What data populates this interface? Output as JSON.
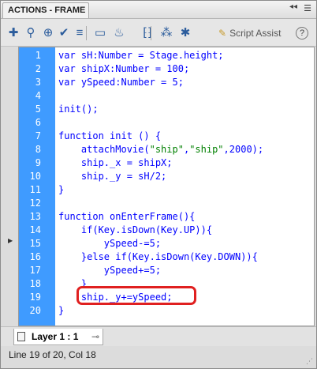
{
  "panel": {
    "title": "ACTIONS - FRAME"
  },
  "toolbar": {
    "buttons": [
      {
        "name": "add-script-item-icon",
        "glyph": "✚"
      },
      {
        "name": "find-icon",
        "glyph": "⚲"
      },
      {
        "name": "target-path-icon",
        "glyph": "⊕"
      },
      {
        "name": "check-syntax-icon",
        "glyph": "✔"
      },
      {
        "name": "auto-format-icon",
        "glyph": "≡"
      },
      {
        "name": "code-hint-icon",
        "glyph": "▭"
      },
      {
        "name": "debug-options-icon",
        "glyph": "♨"
      },
      {
        "name": "collapse-between-braces-icon",
        "glyph": "⁅⁆"
      },
      {
        "name": "collapse-selection-icon",
        "glyph": "⁂"
      },
      {
        "name": "expand-all-icon",
        "glyph": "✱"
      }
    ],
    "script_assist_label": "Script Assist",
    "help_label": "?"
  },
  "code_lines": [
    {
      "num": "1",
      "text": "var sH:Number = Stage.height;"
    },
    {
      "num": "2",
      "text": "var shipX:Number = 100;"
    },
    {
      "num": "3",
      "text": "var ySpeed:Number = 5;"
    },
    {
      "num": "4",
      "text": ""
    },
    {
      "num": "5",
      "text": "init();"
    },
    {
      "num": "6",
      "text": ""
    },
    {
      "num": "7",
      "text": "function init () {"
    },
    {
      "num": "8",
      "text": "    attachMovie(\"ship\",\"ship\",2000);"
    },
    {
      "num": "9",
      "text": "    ship._x = shipX;"
    },
    {
      "num": "10",
      "text": "    ship._y = sH/2;"
    },
    {
      "num": "11",
      "text": "}"
    },
    {
      "num": "12",
      "text": ""
    },
    {
      "num": "13",
      "text": "function onEnterFrame(){"
    },
    {
      "num": "14",
      "text": "    if(Key.isDown(Key.UP)){"
    },
    {
      "num": "15",
      "text": "        ySpeed-=5;"
    },
    {
      "num": "16",
      "text": "    }else if(Key.isDown(Key.DOWN)){"
    },
    {
      "num": "17",
      "text": "        ySpeed+=5;"
    },
    {
      "num": "18",
      "text": "    }"
    },
    {
      "num": "19",
      "text": "    ship._y+=ySpeed;"
    },
    {
      "num": "20",
      "text": "}"
    }
  ],
  "layer_tab": {
    "label": "Layer 1 : 1"
  },
  "status": {
    "text": "Line 19 of 20, Col 18"
  },
  "colors": {
    "gutter": "#3f9bff",
    "code": "#0000ff",
    "string": "#008000",
    "highlight": "#e02020"
  }
}
